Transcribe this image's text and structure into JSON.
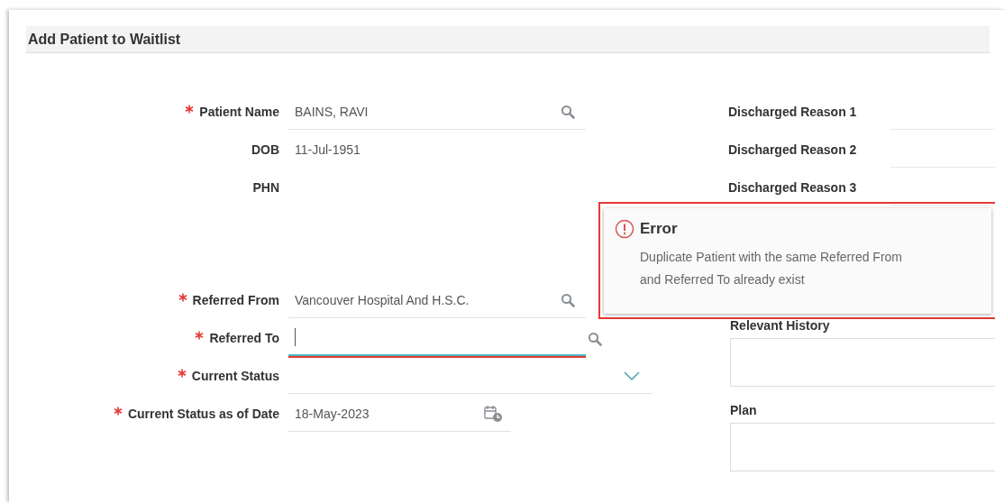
{
  "title": "Add Patient to Waitlist",
  "patient_fields": [
    {
      "label": "Patient Name",
      "required": true,
      "kind": "lookup",
      "value": "BAINS, RAVI",
      "focused": false,
      "invalid": false
    },
    {
      "label": "DOB",
      "required": false,
      "kind": "readonly",
      "value": "11-Jul-1951"
    },
    {
      "label": "PHN",
      "required": false,
      "kind": "readonly"
    }
  ],
  "referral_fields": [
    {
      "label": "Referred From",
      "required": true,
      "kind": "lookup",
      "value": "Vancouver Hospital And H.S.C.",
      "focused": false,
      "invalid": false
    },
    {
      "label": "Referred To",
      "required": true,
      "kind": "lookup",
      "focused": true,
      "invalid": true
    },
    {
      "label": "Current Status",
      "required": true,
      "kind": "dropdown"
    },
    {
      "label": "Current Status as of Date",
      "required": true,
      "kind": "date",
      "value": "18-May-2023"
    }
  ],
  "discharge_fields": [
    {
      "label": "Discharged Reason 1"
    },
    {
      "label": "Discharged Reason 2"
    },
    {
      "label": "Discharged Reason 3"
    }
  ],
  "notes": [
    {
      "label": "Relevant History"
    },
    {
      "label": "Plan"
    }
  ],
  "error_popup": {
    "title": "Error",
    "message": "Duplicate Patient with the same Referred From and Referred To already exist"
  }
}
